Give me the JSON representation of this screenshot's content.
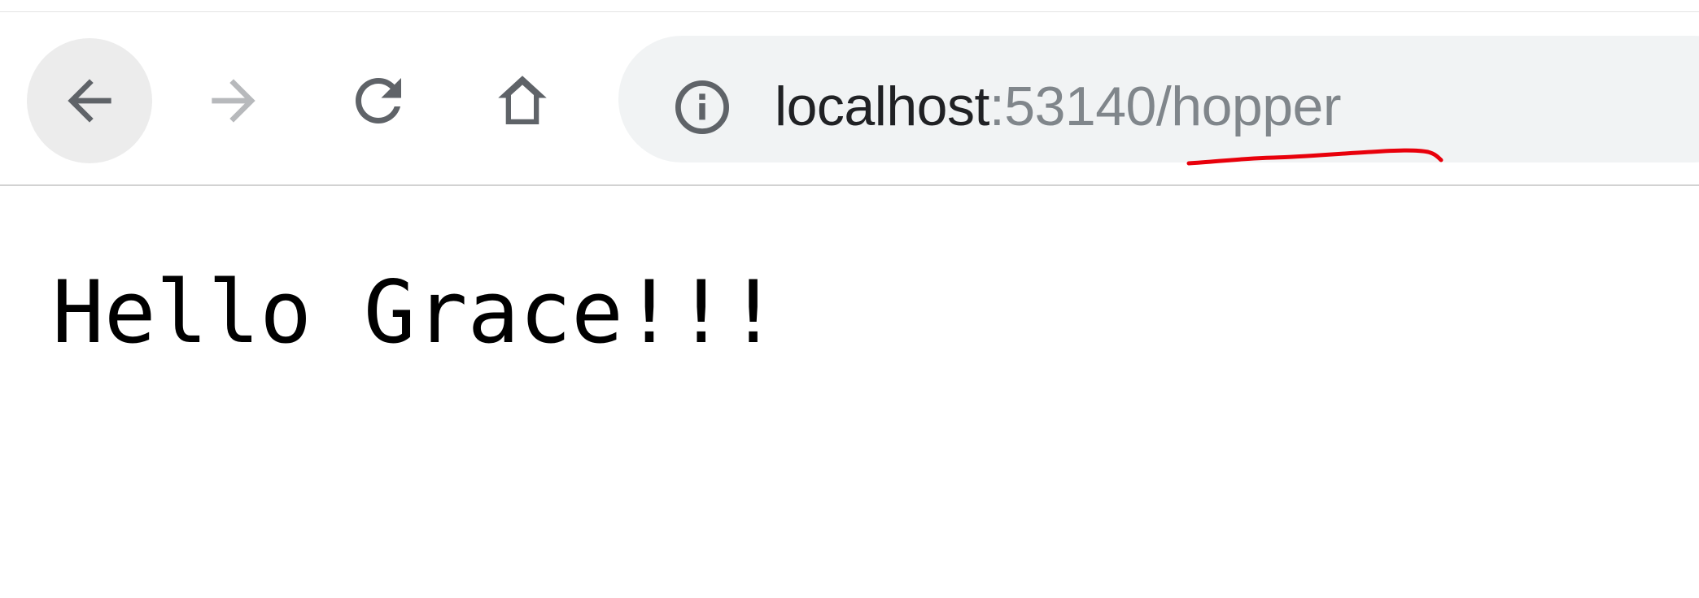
{
  "browser": {
    "toolbar": {
      "back_icon": "arrow-left-icon",
      "forward_icon": "arrow-right-icon",
      "reload_icon": "reload-icon",
      "home_icon": "home-icon"
    },
    "address_bar": {
      "site_info_icon": "info-icon",
      "host": "localhost",
      "port_path": ":53140/hopper",
      "annotation_color": "#e8000b"
    }
  },
  "page": {
    "greeting": "Hello Grace!!!"
  },
  "colors": {
    "icon_active": "#5f6368",
    "icon_disabled": "#b7b9bc",
    "omnibox_bg": "#f1f3f4",
    "back_hover_bg": "#ececec"
  }
}
